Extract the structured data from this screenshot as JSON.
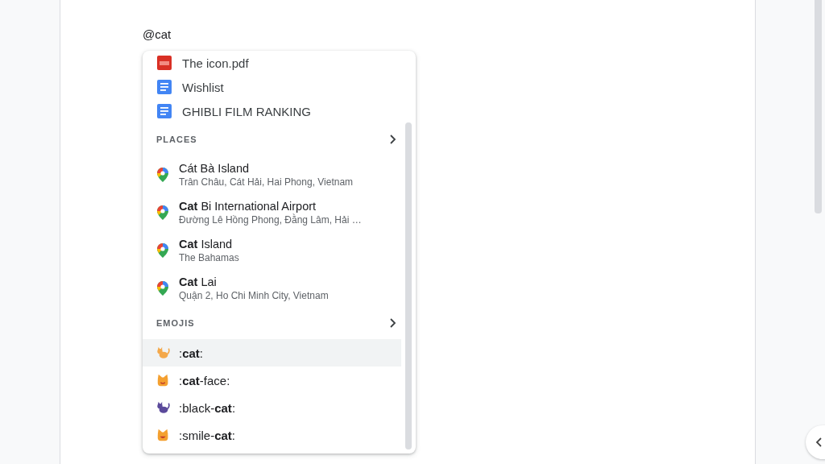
{
  "document": {
    "text": "@cat"
  },
  "files": [
    {
      "kind": "pdf",
      "name": "The icon.pdf"
    },
    {
      "kind": "doc",
      "name": "Wishlist"
    },
    {
      "kind": "doc",
      "name": "GHIBLI FILM RANKING"
    }
  ],
  "places": {
    "heading": "PLACES",
    "items": [
      {
        "name": "Cát Bà Island",
        "address": "Trân Châu, Cát Hải, Hai Phong, Vietnam"
      },
      {
        "name": "**Cat** Bi International Airport",
        "address": "Đường Lê Hồng Phong, Đằng Lâm, Hải …"
      },
      {
        "name": "**Cat** Island",
        "address": "The Bahamas"
      },
      {
        "name": "**Cat** Lai",
        "address": "Quận 2, Ho Chi Minh City, Vietnam"
      }
    ]
  },
  "emojis": {
    "heading": "EMOJIS",
    "items": [
      {
        "kind": "cat",
        "label": ":**cat**:",
        "selected": true
      },
      {
        "kind": "cat-face",
        "label": ":**cat**-face:",
        "selected": false
      },
      {
        "kind": "black-cat",
        "label": ":black-**cat**:",
        "selected": false
      },
      {
        "kind": "smile-cat",
        "label": ":smile-**cat**:",
        "selected": false
      }
    ]
  }
}
